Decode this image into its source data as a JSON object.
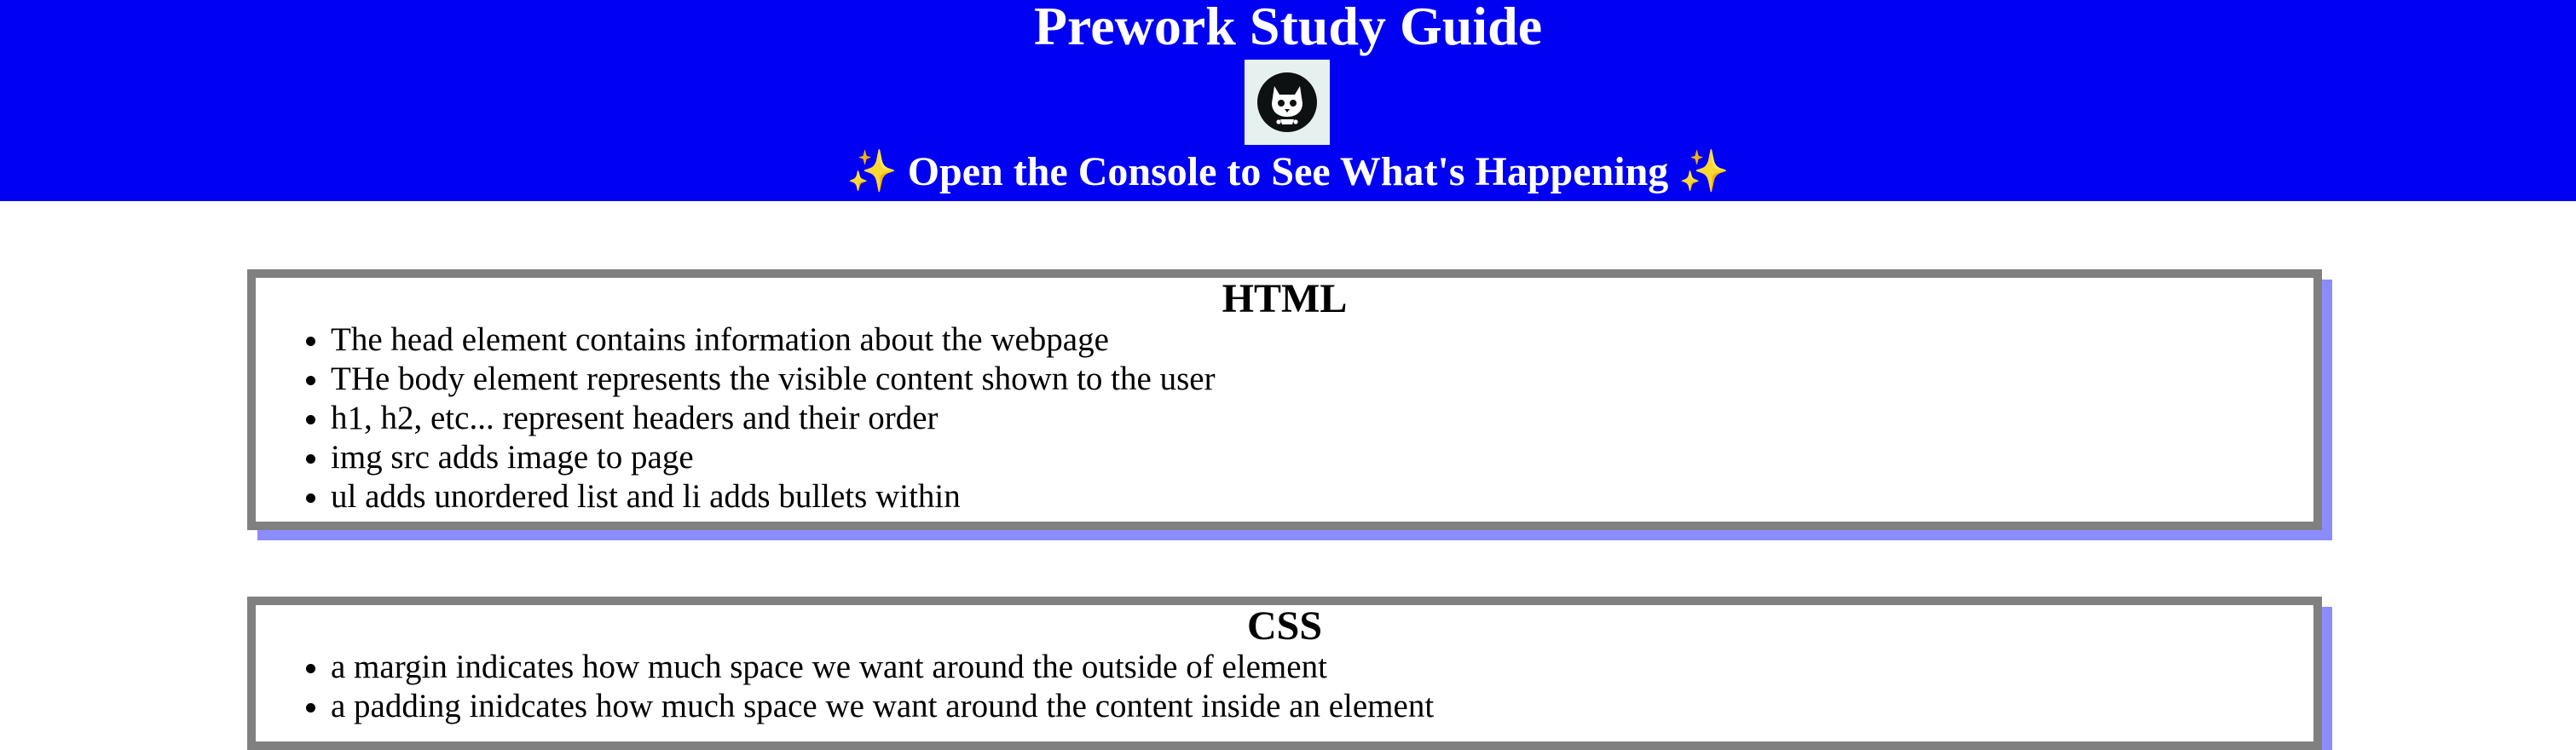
{
  "header": {
    "title": "Prework Study Guide",
    "subtitle_text": "Open the Console to See What's Happening",
    "sparkle": "✨",
    "background_color": "#0000f3",
    "logo_icon": "cat-skull-icon"
  },
  "sections": [
    {
      "heading": "HTML",
      "items": [
        "The head element contains information about the webpage",
        "THe body element represents the visible content shown to the user",
        "h1, h2, etc... represent headers and their order",
        "img src adds image to page",
        "ul adds unordered list and li adds bullets within"
      ]
    },
    {
      "heading": "CSS",
      "items": [
        "a margin indicates how much space we want around the outside of element",
        "a padding inidcates how much space we want around the content inside an element"
      ]
    }
  ],
  "colors": {
    "card_border": "#808080",
    "card_shadow": "#8c8cff",
    "header_text": "#ffffff"
  }
}
